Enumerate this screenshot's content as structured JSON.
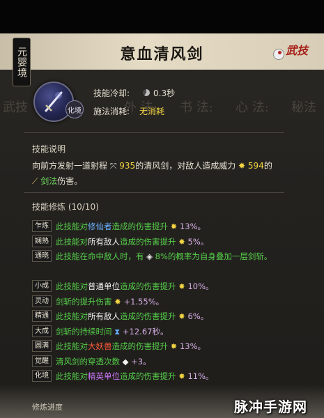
{
  "realm_tag": "元婴境",
  "skill": {
    "name": "意血清风剑",
    "category": "武技",
    "level_badge": "化境",
    "icon": "sword-icon"
  },
  "faded_tabs": [
    "武技",
    "外 法:",
    "书 法:",
    "心 法:",
    "秘法"
  ],
  "stats": {
    "cooldown_label": "技能冷却:",
    "cooldown_value": "0.3秒",
    "cost_label": "施法消耗:",
    "cost_value": "无消耗"
  },
  "description": {
    "title": "技能说明",
    "line1_prefix": "向前方发射一道射程",
    "range": "935",
    "line1_mid": "的清风剑，对敌人造成威力",
    "power": "594",
    "line1_suffix": "的",
    "line2_type": "剑法",
    "line2_suffix": "伤害。"
  },
  "cultivation": {
    "title": "技能修炼 (10/10)",
    "rows": [
      {
        "tag": "乍炼",
        "pre": "此技能对",
        "hl": "修仙者",
        "post": "造成的伤害提升",
        "val": "13%。"
      },
      {
        "tag": "娴熟",
        "pre": "此技能对",
        "hl": "所有敌人",
        "post": "造成的伤害提升",
        "val": "5%。"
      },
      {
        "tag": "通晓",
        "pre": "此技能在命中敌人时，有",
        "hl": "",
        "post": "8%的概率为自身叠加一层剑斩。",
        "val": ""
      },
      {
        "tag": "小成",
        "pre": "此技能对",
        "hl": "普通单位",
        "post": "造成的伤害提升",
        "val": "10%。"
      },
      {
        "tag": "灵动",
        "pre": "剑斩的提升伤害",
        "hl": "",
        "post": "",
        "val": "+1.55%。"
      },
      {
        "tag": "精通",
        "pre": "此技能对",
        "hl": "所有敌人",
        "post": "造成的伤害提升",
        "val": "6%。"
      },
      {
        "tag": "大成",
        "pre": "剑斩的持续时间",
        "hl": "",
        "post": "",
        "val": "+12.67秒。"
      },
      {
        "tag": "圆满",
        "pre": "此技能对",
        "hl": "大妖兽",
        "post": "造成的伤害提升",
        "val": "13%。"
      },
      {
        "tag": "觉醒",
        "pre": "清风剑的穿透次数",
        "hl": "",
        "post": "",
        "val": "+3。"
      },
      {
        "tag": "化境",
        "pre": "此技能对",
        "hl": "精英单位",
        "post": "造成的伤害提升",
        "val": "11%。"
      }
    ]
  },
  "progress_label": "修炼进度",
  "watermark": "脉冲手游网",
  "colors": {
    "accent_yellow": "#f1d442",
    "text_green": "#55d04a",
    "category_red": "#a51f17"
  }
}
